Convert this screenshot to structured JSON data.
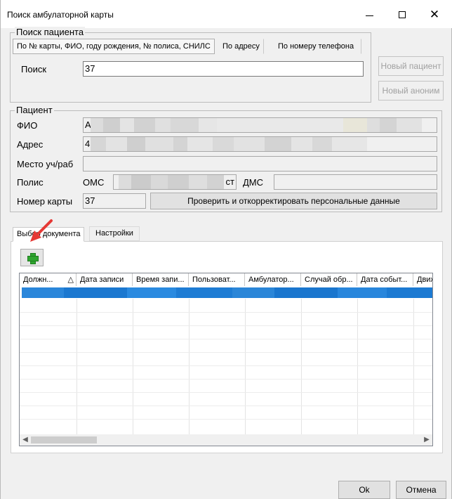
{
  "window": {
    "title": "Поиск амбулаторной карты",
    "minimize_glyph": "",
    "close_glyph": "✕"
  },
  "search_group": {
    "legend": "Поиск пациента",
    "tabs": [
      {
        "label": "По № карты, ФИО, году рождения, № полиса, СНИЛС",
        "active": true
      },
      {
        "label": "По адресу",
        "active": false
      },
      {
        "label": "По номеру телефона",
        "active": false
      }
    ],
    "search_label": "Поиск",
    "search_value": "37",
    "new_patient_label": "Новый пациент",
    "new_anonymous_label": "Новый аноним"
  },
  "patient_group": {
    "legend": "Пациент",
    "fio_label": "ФИО",
    "fio_value_visible": "А",
    "address_label": "Адрес",
    "address_value_visible": "4",
    "place_label": "Место уч/раб",
    "policy_label": "Полис",
    "oms_label": "ОМС",
    "oms_value_visible": "ст",
    "dms_label": "ДМС",
    "card_number_label": "Номер карты",
    "card_number_value": "37",
    "verify_button_label": "Проверить и откорректировать персональные данные"
  },
  "lower_panel": {
    "tabs": [
      {
        "label": "Выбор документа",
        "active": true
      },
      {
        "label": "Настройки",
        "active": false
      }
    ],
    "add_icon": "plus-icon",
    "grid": {
      "columns": [
        "Должн...",
        "Дата записи",
        "Время запи...",
        "Пользоват...",
        "Амбулатор...",
        "Случай обр...",
        "Дата событ...",
        "Движ"
      ],
      "sort_glyph": "△",
      "selected_row_index": 0
    }
  },
  "footer": {
    "ok_label": "Ok",
    "cancel_label": "Отмена"
  },
  "colors": {
    "selection": "#1f7fd6",
    "accent_arrow": "#e53935",
    "add_icon": "#2fa52f"
  }
}
